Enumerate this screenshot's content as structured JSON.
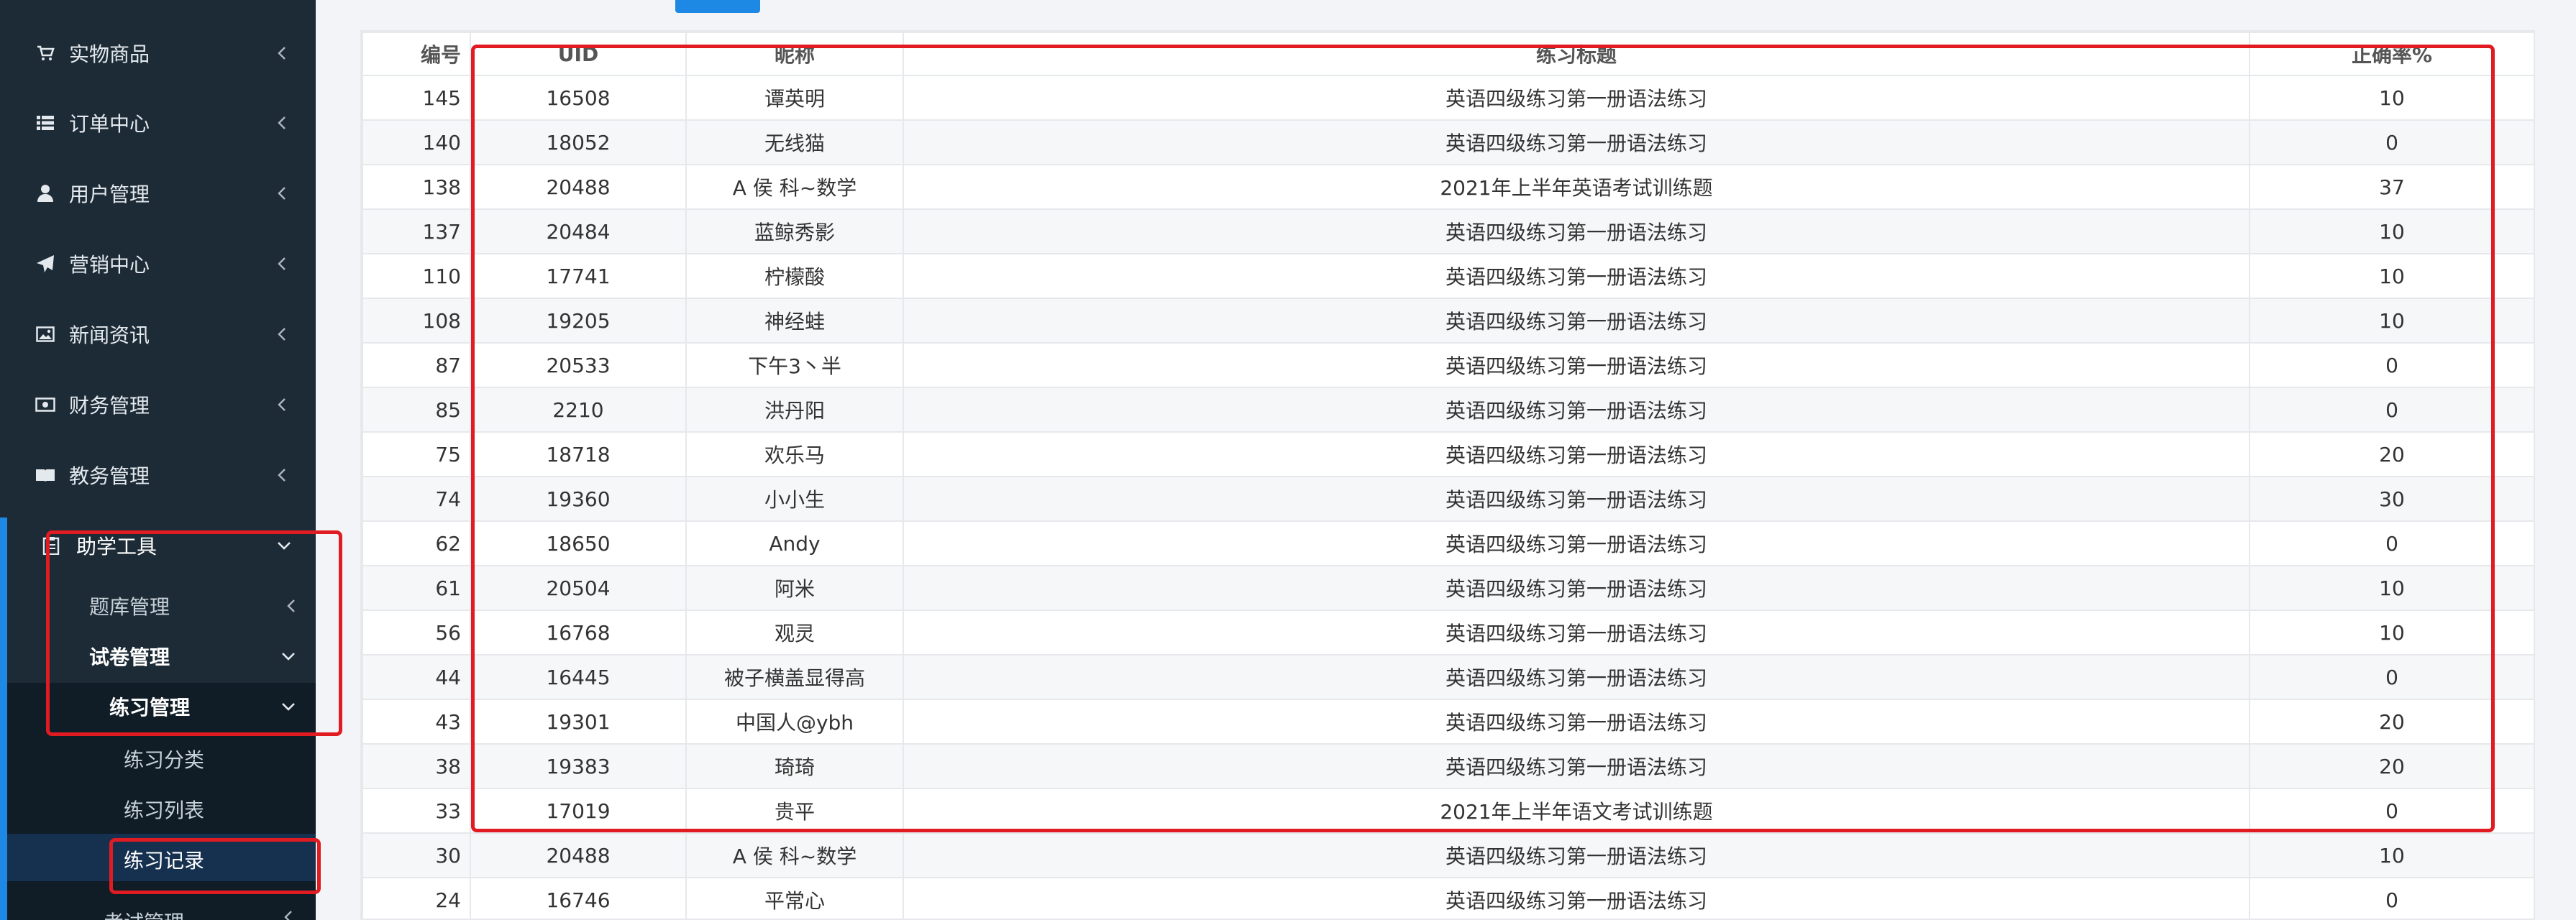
{
  "sidebar": {
    "items": [
      {
        "label": "实物商品",
        "icon": "cart-icon"
      },
      {
        "label": "订单中心",
        "icon": "list-icon"
      },
      {
        "label": "用户管理",
        "icon": "user-icon"
      },
      {
        "label": "营销中心",
        "icon": "send-icon"
      },
      {
        "label": "新闻资讯",
        "icon": "image-icon"
      },
      {
        "label": "财务管理",
        "icon": "money-icon"
      },
      {
        "label": "教务管理",
        "icon": "book-icon"
      }
    ],
    "helper": {
      "label": "助学工具",
      "icon": "clipboard-icon"
    },
    "question_bank": "题库管理",
    "paper_mgmt": "试卷管理",
    "practice_mgmt": "练习管理",
    "leaves": [
      "练习分类",
      "练习列表",
      "练习记录"
    ],
    "exam_mgmt": "考试管理"
  },
  "table": {
    "headers": [
      "编号",
      "UID",
      "昵称",
      "练习标题",
      "正确率%"
    ],
    "rows": [
      [
        "145",
        "16508",
        "谭英明",
        "英语四级练习第一册语法练习",
        "10"
      ],
      [
        "140",
        "18052",
        "无线猫",
        "英语四级练习第一册语法练习",
        "0"
      ],
      [
        "138",
        "20488",
        "A 侯 科~数学",
        "2021年上半年英语考试训练题",
        "37"
      ],
      [
        "137",
        "20484",
        "蓝鲸秀影",
        "英语四级练习第一册语法练习",
        "10"
      ],
      [
        "110",
        "17741",
        "柠檬酸",
        "英语四级练习第一册语法练习",
        "10"
      ],
      [
        "108",
        "19205",
        "神经蛙",
        "英语四级练习第一册语法练习",
        "10"
      ],
      [
        "87",
        "20533",
        "下午3丶半",
        "英语四级练习第一册语法练习",
        "0"
      ],
      [
        "85",
        "2210",
        "洪丹阳",
        "英语四级练习第一册语法练习",
        "0"
      ],
      [
        "75",
        "18718",
        "欢乐马",
        "英语四级练习第一册语法练习",
        "20"
      ],
      [
        "74",
        "19360",
        "小小生",
        "英语四级练习第一册语法练习",
        "30"
      ],
      [
        "62",
        "18650",
        "Andy",
        "英语四级练习第一册语法练习",
        "0"
      ],
      [
        "61",
        "20504",
        "阿米",
        "英语四级练习第一册语法练习",
        "10"
      ],
      [
        "56",
        "16768",
        "观灵",
        "英语四级练习第一册语法练习",
        "10"
      ],
      [
        "44",
        "16445",
        "被子横盖显得高",
        "英语四级练习第一册语法练习",
        "0"
      ],
      [
        "43",
        "19301",
        "中国人@ybh",
        "英语四级练习第一册语法练习",
        "20"
      ],
      [
        "38",
        "19383",
        "琦琦",
        "英语四级练习第一册语法练习",
        "20"
      ],
      [
        "33",
        "17019",
        "贵平",
        "2021年上半年语文考试训练题",
        "0"
      ],
      [
        "30",
        "20488",
        "A 侯 科~数学",
        "英语四级练习第一册语法练习",
        "10"
      ],
      [
        "24",
        "16746",
        "平常心",
        "英语四级练习第一册语法练习",
        "0"
      ]
    ]
  },
  "colors": {
    "sidebar_bg": "#1c2b36",
    "accent": "#1e88e5",
    "annotation": "#e11b22"
  }
}
